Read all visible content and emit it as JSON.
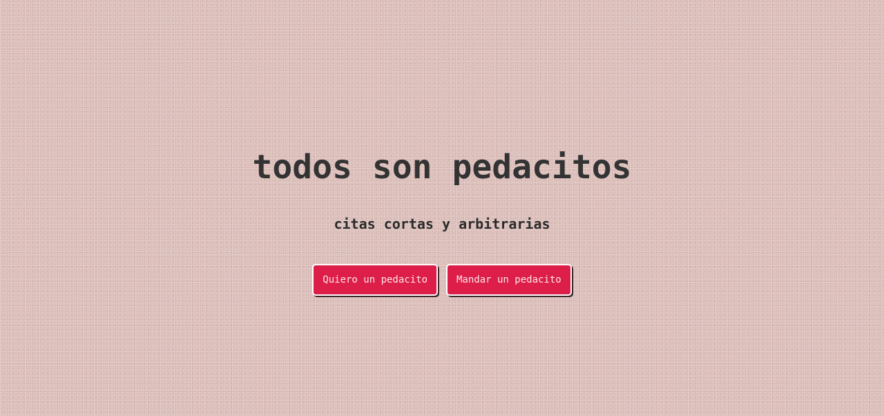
{
  "hero": {
    "title": "todos son pedacitos",
    "subtitle": "citas cortas y arbitrarias"
  },
  "actions": {
    "request_label": "Quiero un pedacito",
    "send_label": "Mandar un pedacito"
  },
  "colors": {
    "background": "#dcc0bc",
    "button": "#dc1e48",
    "text": "#333333"
  }
}
